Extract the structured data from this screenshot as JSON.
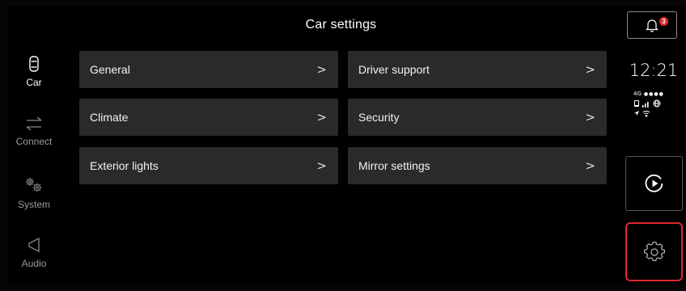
{
  "header": {
    "title": "Car settings"
  },
  "nav": {
    "items": [
      {
        "label": "Car",
        "icon": "car-icon",
        "active": true
      },
      {
        "label": "Connect",
        "icon": "connect-arrows-icon",
        "active": false
      },
      {
        "label": "System",
        "icon": "gears-icon",
        "active": false
      },
      {
        "label": "Audio",
        "icon": "speaker-icon",
        "active": false
      }
    ]
  },
  "tiles": [
    {
      "label": "General",
      "chevron": ">"
    },
    {
      "label": "Driver support",
      "chevron": ">"
    },
    {
      "label": "Climate",
      "chevron": ">"
    },
    {
      "label": "Security",
      "chevron": ">"
    },
    {
      "label": "Exterior lights",
      "chevron": ">"
    },
    {
      "label": "Mirror settings",
      "chevron": ">"
    }
  ],
  "right_panel": {
    "notification_count": "3",
    "clock": "12:21",
    "network": "4G",
    "signal_dots": "●●●●",
    "media_icon": "play-circle-icon",
    "settings_icon": "gear-icon"
  },
  "colors": {
    "tile_bg": "#2a2a2a",
    "highlight": "#e0262f",
    "badge": "#e32929"
  }
}
